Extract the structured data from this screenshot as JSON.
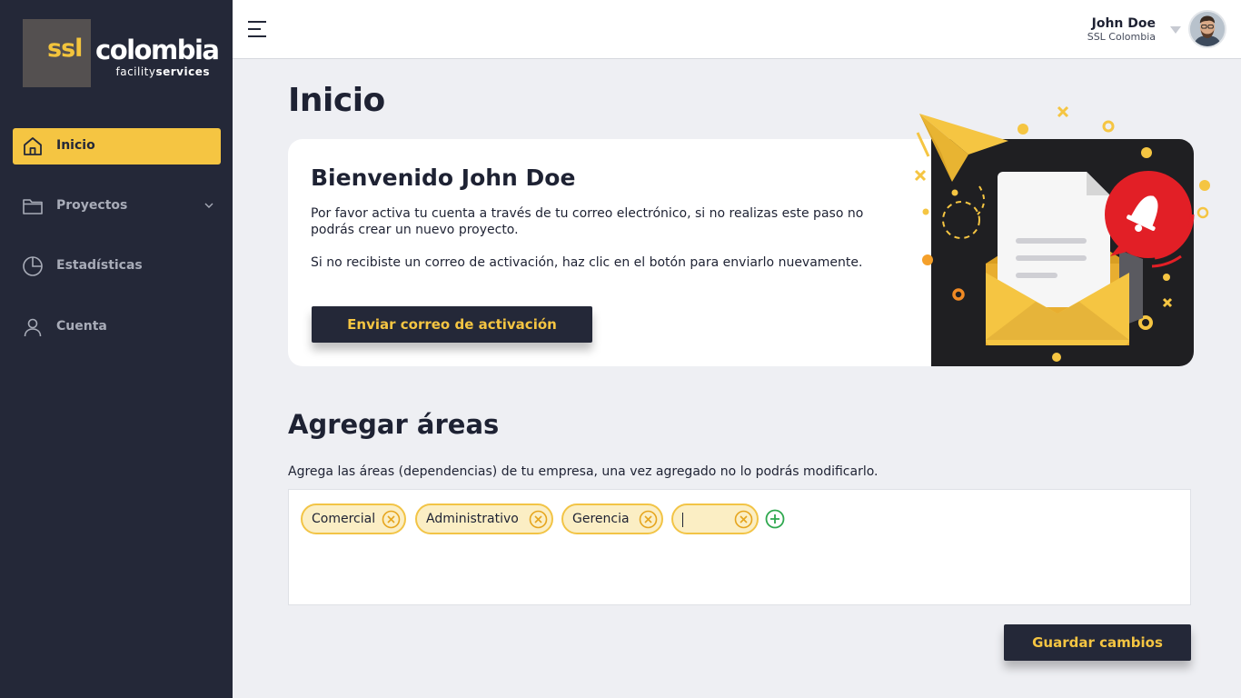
{
  "brand": {
    "ssl": "ssl",
    "name": "colombia",
    "sub_light": "facility",
    "sub_bold": "services"
  },
  "sidebar": {
    "items": [
      {
        "label": "Inicio",
        "icon": "home-icon",
        "active": true
      },
      {
        "label": "Proyectos",
        "icon": "folder-icon",
        "active": false
      },
      {
        "label": "Estadísticas",
        "icon": "pie-chart-icon",
        "active": false
      },
      {
        "label": "Cuenta",
        "icon": "user-icon",
        "active": false
      }
    ]
  },
  "header": {
    "user_name": "John Doe",
    "company": "SSL Colombia"
  },
  "main": {
    "title": "Inicio",
    "welcome": {
      "heading": "Bienvenido John Doe",
      "p1": "Por favor activa tu cuenta a través de tu correo electrónico, si no realizas este paso no podrás crear un nuevo proyecto.",
      "p2": "Si no recibiste un correo de activación, haz clic en el botón para enviarlo nuevamente.",
      "button": "Enviar correo de activación"
    },
    "areas": {
      "title": "Agregar áreas",
      "description": "Agrega las áreas (dependencias) de tu empresa, una vez agregado no lo podrás modificarlo.",
      "tags": [
        "Comercial",
        "Administrativo",
        "Gerencia"
      ],
      "new_tag_value": ""
    },
    "save_button": "Guardar cambios"
  },
  "colors": {
    "sidebar_bg": "#242838",
    "accent": "#f5c542",
    "tag_bg": "#fbeec4",
    "add_green": "#2fa84f",
    "bell_red": "#e02424"
  }
}
